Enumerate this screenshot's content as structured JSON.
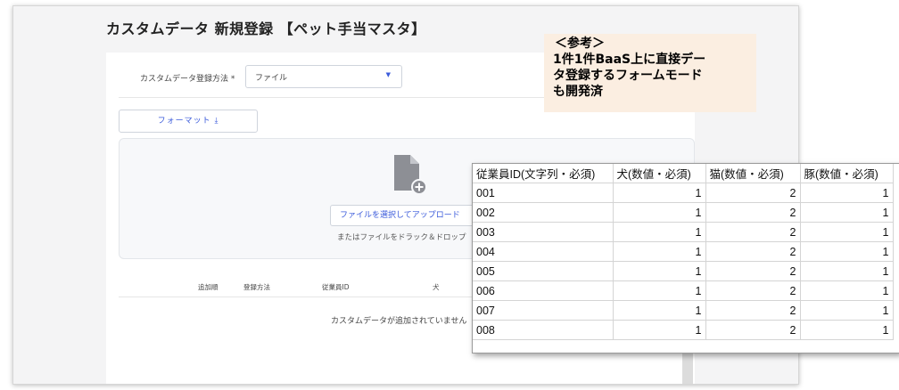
{
  "page_title": "カスタムデータ 新規登録 【ペット手当マスタ】",
  "form": {
    "method_label": "カスタムデータ登録方法 *",
    "method_value": "ファイル",
    "format_button": "フォーマット ⤓",
    "upload_button": "ファイルを選択してアップロード",
    "drop_text": "またはファイルをドラック＆ドロップ",
    "file_icon": "file-add-icon"
  },
  "table": {
    "headers": [
      "追加順",
      "登録方法",
      "従業員ID",
      "犬"
    ],
    "empty_text": "カスタムデータが追加されていません"
  },
  "note": {
    "lines": [
      "＜参考＞",
      "1件1件BaaS上に直接デー",
      "タ登録するフォームモード",
      "も開発済"
    ]
  },
  "spreadsheet": {
    "headers": [
      "従業員ID(文字列・必須)",
      "犬(数値・必須)",
      "猫(数値・必須)",
      "豚(数値・必須)"
    ],
    "rows": [
      [
        "001",
        "1",
        "2",
        "1"
      ],
      [
        "002",
        "1",
        "2",
        "1"
      ],
      [
        "003",
        "1",
        "2",
        "1"
      ],
      [
        "004",
        "1",
        "2",
        "1"
      ],
      [
        "005",
        "1",
        "2",
        "1"
      ],
      [
        "006",
        "1",
        "2",
        "1"
      ],
      [
        "007",
        "1",
        "2",
        "1"
      ],
      [
        "008",
        "1",
        "2",
        "1"
      ]
    ]
  },
  "colors": {
    "accent": "#3b5bdb",
    "note_bg": "#fbeee1"
  }
}
